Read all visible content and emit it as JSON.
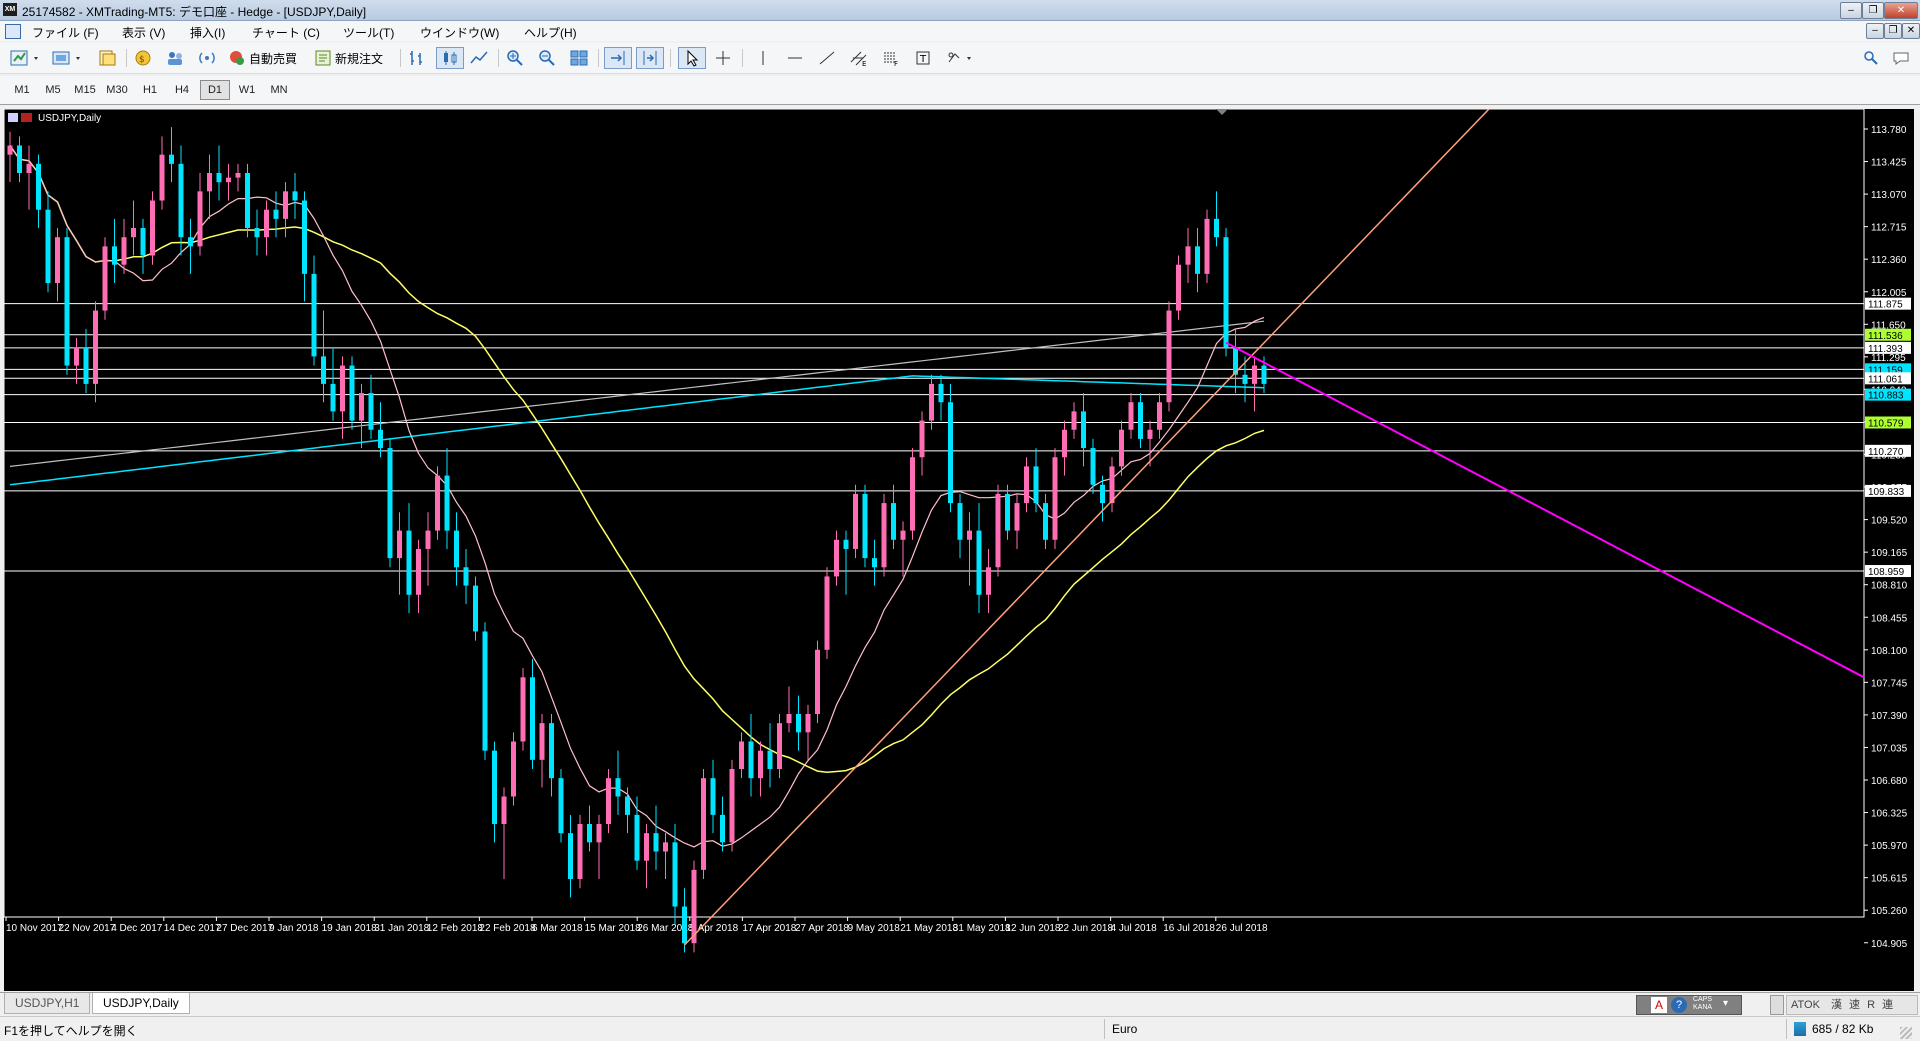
{
  "window": {
    "title": "25174582 - XMTrading-MT5: デモ口座 - Hedge - [USDJPY,Daily]",
    "app_icon": "XM"
  },
  "menu": [
    "ファイル (F)",
    "表示 (V)",
    "挿入(I)",
    "チャート (C)",
    "ツール(T)",
    "ウインドウ(W)",
    "ヘルプ(H)"
  ],
  "toolbar": {
    "auto_trade": "自動売買",
    "new_order": "新規注文"
  },
  "timeframes": [
    "M1",
    "M5",
    "M15",
    "M30",
    "H1",
    "H4",
    "D1",
    "W1",
    "MN"
  ],
  "active_timeframe": "D1",
  "tabs": [
    "USDJPY,H1",
    "USDJPY,Daily"
  ],
  "active_tab": "USDJPY,Daily",
  "status": {
    "help": "F1を押してヘルプを開く",
    "profile": "Euro",
    "traffic": "685 / 82 Kb"
  },
  "ime": {
    "mode": "A",
    "kana": "KANA",
    "caps": "CAPS",
    "atok": "ATOK",
    "atok_modes": "漢 速 R 連"
  },
  "chart_data": {
    "type": "candlestick",
    "symbol_label": "USDJPY,Daily",
    "y_ticks": [
      "113.780",
      "113.425",
      "113.070",
      "112.715",
      "112.360",
      "112.005",
      "111.650",
      "111.295",
      "110.940",
      "110.585",
      "110.230",
      "109.875",
      "109.520",
      "109.165",
      "108.810",
      "108.455",
      "108.100",
      "107.745",
      "107.390",
      "107.035",
      "106.680",
      "106.325",
      "105.970",
      "105.615",
      "105.260",
      "104.905"
    ],
    "x_ticks": [
      "10 Nov 2017",
      "22 Nov 2017",
      "4 Dec 2017",
      "14 Dec 2017",
      "27 Dec 2017",
      "9 Jan 2018",
      "19 Jan 2018",
      "31 Jan 2018",
      "12 Feb 2018",
      "22 Feb 2018",
      "6 Mar 2018",
      "15 Mar 2018",
      "26 Mar 2018",
      "5 Apr 2018",
      "17 Apr 2018",
      "27 Apr 2018",
      "9 May 2018",
      "21 May 2018",
      "31 May 2018",
      "12 Jun 2018",
      "22 Jun 2018",
      "4 Jul 2018",
      "16 Jul 2018",
      "26 Jul 2018"
    ],
    "horizontal_levels": [
      {
        "value": 111.875,
        "label": "111.875",
        "label_bg": "#ffffff"
      },
      {
        "value": 111.536,
        "label": "111.536",
        "label_bg": "#adff2f"
      },
      {
        "value": 111.393,
        "label": "111.393",
        "label_bg": "#ffffff"
      },
      {
        "value": 111.159,
        "label": "111.159",
        "label_bg": "#00e5ff"
      },
      {
        "value": 111.061,
        "label": "111.061",
        "label_bg": "#ffffff"
      },
      {
        "value": 110.883,
        "label": "110.883",
        "label_bg": "#00e5ff"
      },
      {
        "value": 110.579,
        "label": "110.579",
        "label_bg": "#adff2f"
      },
      {
        "value": 110.27,
        "label": "110.270",
        "label_bg": "#ffffff"
      },
      {
        "value": 109.833,
        "label": "109.833",
        "label_bg": "#ffffff"
      },
      {
        "value": 108.959,
        "label": "108.959",
        "label_bg": "#ffffff"
      }
    ],
    "colors": {
      "background": "#000000",
      "bull": "#ff6eb4",
      "bear": "#00e5ff",
      "ma_fast": "#ffc0cb",
      "ma_mid": "#ffff66",
      "ma_slow": "#00e5ff",
      "ma_long": "#c0c0c0",
      "trend_up": "#ffa07a",
      "trend_down": "#ff00ff"
    },
    "ohlc": [
      [
        113.5,
        113.75,
        113.2,
        113.6
      ],
      [
        113.6,
        113.7,
        113.2,
        113.3
      ],
      [
        113.3,
        113.6,
        112.9,
        113.4
      ],
      [
        113.4,
        113.5,
        112.7,
        112.9
      ],
      [
        112.9,
        113.1,
        112.0,
        112.1
      ],
      [
        112.1,
        112.7,
        111.9,
        112.6
      ],
      [
        112.6,
        112.7,
        111.1,
        111.2
      ],
      [
        111.2,
        111.5,
        111.0,
        111.4
      ],
      [
        111.4,
        111.6,
        110.9,
        111.0
      ],
      [
        111.0,
        111.9,
        110.8,
        111.8
      ],
      [
        111.8,
        112.6,
        111.7,
        112.5
      ],
      [
        112.5,
        112.8,
        112.1,
        112.3
      ],
      [
        112.3,
        112.8,
        112.2,
        112.6
      ],
      [
        112.6,
        113.0,
        112.4,
        112.7
      ],
      [
        112.7,
        112.8,
        112.2,
        112.4
      ],
      [
        112.4,
        113.1,
        112.3,
        113.0
      ],
      [
        113.0,
        113.7,
        112.9,
        113.5
      ],
      [
        113.5,
        113.8,
        113.2,
        113.4
      ],
      [
        113.4,
        113.6,
        112.4,
        112.6
      ],
      [
        112.6,
        112.8,
        112.2,
        112.5
      ],
      [
        112.5,
        113.3,
        112.4,
        113.1
      ],
      [
        113.1,
        113.5,
        112.8,
        113.3
      ],
      [
        113.3,
        113.6,
        113.0,
        113.2
      ],
      [
        113.2,
        113.4,
        113.0,
        113.25
      ],
      [
        113.25,
        113.4,
        113.1,
        113.3
      ],
      [
        113.3,
        113.4,
        112.6,
        112.7
      ],
      [
        112.7,
        112.9,
        112.4,
        112.6
      ],
      [
        112.6,
        113.0,
        112.4,
        112.9
      ],
      [
        112.9,
        113.1,
        112.6,
        112.8
      ],
      [
        112.8,
        113.2,
        112.6,
        113.1
      ],
      [
        113.1,
        113.3,
        112.8,
        113.0
      ],
      [
        113.0,
        113.1,
        111.9,
        112.2
      ],
      [
        112.2,
        112.4,
        111.2,
        111.3
      ],
      [
        111.3,
        111.8,
        110.8,
        111.0
      ],
      [
        111.0,
        111.4,
        110.6,
        110.7
      ],
      [
        110.7,
        111.3,
        110.4,
        111.2
      ],
      [
        111.2,
        111.3,
        110.5,
        110.6
      ],
      [
        110.6,
        111.0,
        110.3,
        110.9
      ],
      [
        110.9,
        111.1,
        110.4,
        110.5
      ],
      [
        110.5,
        110.8,
        110.2,
        110.3
      ],
      [
        110.3,
        110.4,
        109.0,
        109.1
      ],
      [
        109.1,
        109.6,
        108.7,
        109.4
      ],
      [
        109.4,
        109.7,
        108.5,
        108.7
      ],
      [
        108.7,
        109.3,
        108.5,
        109.2
      ],
      [
        109.2,
        109.6,
        108.8,
        109.4
      ],
      [
        109.4,
        110.1,
        109.3,
        110.0
      ],
      [
        110.0,
        110.3,
        109.2,
        109.4
      ],
      [
        109.4,
        109.6,
        108.8,
        109.0
      ],
      [
        109.0,
        109.2,
        108.6,
        108.8
      ],
      [
        108.8,
        108.9,
        108.2,
        108.3
      ],
      [
        108.3,
        108.4,
        106.9,
        107.0
      ],
      [
        107.0,
        107.1,
        106.0,
        106.2
      ],
      [
        106.2,
        106.6,
        105.6,
        106.5
      ],
      [
        106.5,
        107.2,
        106.4,
        107.1
      ],
      [
        107.1,
        107.9,
        107.0,
        107.8
      ],
      [
        107.8,
        108.0,
        106.8,
        106.9
      ],
      [
        106.9,
        107.4,
        106.6,
        107.3
      ],
      [
        107.3,
        107.4,
        106.5,
        106.7
      ],
      [
        106.7,
        106.8,
        106.0,
        106.1
      ],
      [
        106.1,
        106.3,
        105.4,
        105.6
      ],
      [
        105.6,
        106.3,
        105.5,
        106.2
      ],
      [
        106.2,
        106.4,
        105.9,
        106.0
      ],
      [
        106.0,
        106.3,
        105.6,
        106.2
      ],
      [
        106.2,
        106.8,
        106.1,
        106.7
      ],
      [
        106.7,
        107.0,
        106.3,
        106.5
      ],
      [
        106.5,
        106.6,
        106.1,
        106.3
      ],
      [
        106.3,
        106.5,
        105.7,
        105.8
      ],
      [
        105.8,
        106.2,
        105.5,
        106.1
      ],
      [
        106.1,
        106.4,
        105.7,
        105.9
      ],
      [
        105.9,
        106.1,
        105.6,
        106.0
      ],
      [
        106.0,
        106.2,
        105.1,
        105.3
      ],
      [
        105.3,
        105.5,
        104.8,
        104.9
      ],
      [
        104.9,
        105.8,
        104.8,
        105.7
      ],
      [
        105.7,
        106.8,
        105.6,
        106.7
      ],
      [
        106.7,
        106.9,
        106.1,
        106.3
      ],
      [
        106.3,
        106.5,
        105.9,
        106.0
      ],
      [
        106.0,
        106.9,
        105.9,
        106.8
      ],
      [
        106.8,
        107.2,
        106.7,
        107.1
      ],
      [
        107.1,
        107.4,
        106.5,
        106.7
      ],
      [
        106.7,
        107.1,
        106.5,
        107.0
      ],
      [
        107.0,
        107.3,
        106.6,
        106.8
      ],
      [
        106.8,
        107.4,
        106.7,
        107.3
      ],
      [
        107.3,
        107.7,
        107.2,
        107.4
      ],
      [
        107.4,
        107.6,
        107.0,
        107.2
      ],
      [
        107.2,
        107.5,
        106.9,
        107.4
      ],
      [
        107.4,
        108.2,
        107.3,
        108.1
      ],
      [
        108.1,
        109.0,
        108.0,
        108.9
      ],
      [
        108.9,
        109.4,
        108.8,
        109.3
      ],
      [
        109.3,
        109.4,
        108.7,
        109.2
      ],
      [
        109.2,
        109.9,
        109.1,
        109.8
      ],
      [
        109.8,
        109.9,
        109.0,
        109.1
      ],
      [
        109.1,
        109.3,
        108.8,
        109.0
      ],
      [
        109.0,
        109.8,
        108.9,
        109.7
      ],
      [
        109.7,
        109.9,
        109.2,
        109.3
      ],
      [
        109.3,
        109.5,
        108.9,
        109.4
      ],
      [
        109.4,
        110.3,
        109.3,
        110.2
      ],
      [
        110.2,
        110.7,
        110.0,
        110.6
      ],
      [
        110.6,
        111.1,
        110.5,
        111.0
      ],
      [
        111.0,
        111.1,
        110.6,
        110.8
      ],
      [
        110.8,
        111.0,
        109.6,
        109.7
      ],
      [
        109.7,
        109.8,
        109.1,
        109.3
      ],
      [
        109.3,
        109.6,
        108.8,
        109.4
      ],
      [
        109.4,
        109.7,
        108.5,
        108.7
      ],
      [
        108.7,
        109.2,
        108.5,
        109.0
      ],
      [
        109.0,
        109.9,
        108.9,
        109.8
      ],
      [
        109.8,
        109.9,
        109.3,
        109.4
      ],
      [
        109.4,
        109.8,
        109.2,
        109.7
      ],
      [
        109.7,
        110.2,
        109.6,
        110.1
      ],
      [
        110.1,
        110.3,
        109.6,
        109.7
      ],
      [
        109.7,
        109.8,
        109.2,
        109.3
      ],
      [
        109.3,
        110.3,
        109.2,
        110.2
      ],
      [
        110.2,
        110.6,
        110.0,
        110.5
      ],
      [
        110.5,
        110.8,
        110.4,
        110.7
      ],
      [
        110.7,
        110.9,
        110.1,
        110.3
      ],
      [
        110.3,
        110.4,
        109.8,
        109.9
      ],
      [
        109.9,
        110.0,
        109.5,
        109.7
      ],
      [
        109.7,
        110.2,
        109.6,
        110.1
      ],
      [
        110.1,
        110.6,
        110.0,
        110.5
      ],
      [
        110.5,
        110.9,
        110.4,
        110.8
      ],
      [
        110.8,
        110.9,
        110.3,
        110.4
      ],
      [
        110.4,
        110.6,
        110.1,
        110.5
      ],
      [
        110.5,
        110.9,
        110.4,
        110.8
      ],
      [
        110.8,
        111.9,
        110.7,
        111.8
      ],
      [
        111.8,
        112.4,
        111.7,
        112.3
      ],
      [
        112.3,
        112.7,
        112.1,
        112.5
      ],
      [
        112.5,
        112.7,
        112.0,
        112.2
      ],
      [
        112.2,
        112.9,
        112.1,
        112.8
      ],
      [
        112.8,
        113.1,
        112.5,
        112.6
      ],
      [
        112.6,
        112.7,
        111.3,
        111.4
      ],
      [
        111.4,
        111.6,
        110.9,
        111.1
      ],
      [
        111.1,
        111.3,
        110.8,
        111.0
      ],
      [
        111.0,
        111.3,
        110.7,
        111.2
      ],
      [
        111.2,
        111.3,
        110.9,
        111.0
      ]
    ]
  }
}
